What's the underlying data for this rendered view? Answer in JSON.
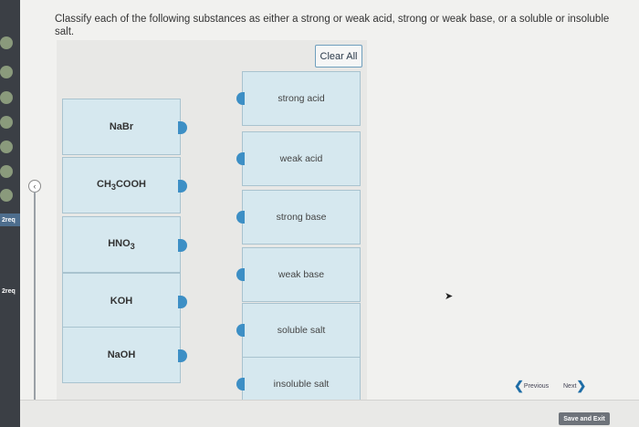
{
  "question": "Classify each of the following substances as either a strong or weak acid, strong or weak base, or a soluble or insoluble salt.",
  "clear_all_label": "Clear All",
  "sources": [
    {
      "html": "NaBr"
    },
    {
      "html": "CH<sub>3</sub>COOH"
    },
    {
      "html": "HNO<sub>3</sub>"
    },
    {
      "html": "KOH"
    },
    {
      "html": "NaOH"
    }
  ],
  "targets": [
    {
      "label": "strong acid"
    },
    {
      "label": "weak acid"
    },
    {
      "label": "strong base"
    },
    {
      "label": "weak base"
    },
    {
      "label": "soluble salt"
    },
    {
      "label": "insoluble salt"
    }
  ],
  "sidebar": {
    "labels": [
      "2req",
      "2req"
    ]
  },
  "navigation": {
    "previous_label": "Previous",
    "next_label": "Next"
  },
  "save_label": "Save and Exit",
  "colors": {
    "accent": "#3d8fc5",
    "card_fill": "#d6e8ef",
    "sidebar": "#3b3f45"
  }
}
